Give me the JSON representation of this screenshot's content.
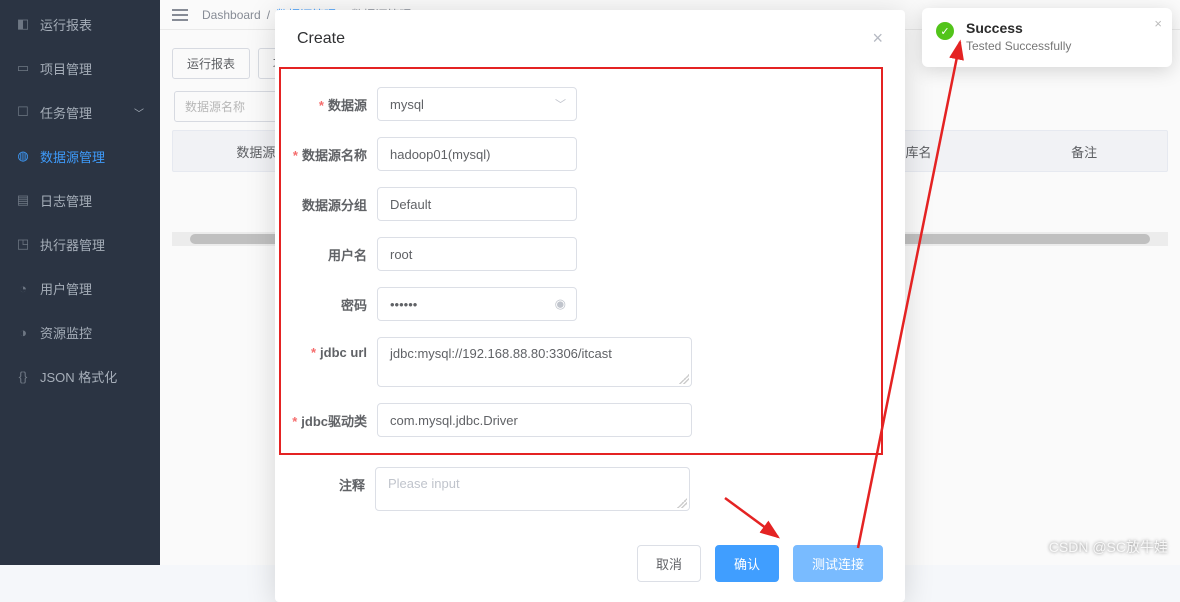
{
  "sidebar": {
    "items": [
      {
        "label": "运行报表"
      },
      {
        "label": "项目管理"
      },
      {
        "label": "任务管理"
      },
      {
        "label": "数据源管理"
      },
      {
        "label": "日志管理"
      },
      {
        "label": "执行器管理"
      },
      {
        "label": "用户管理"
      },
      {
        "label": "资源监控"
      },
      {
        "label": "JSON 格式化"
      }
    ]
  },
  "breadcrumb": {
    "home": "Dashboard",
    "mid": "数据源管理",
    "last": "数据源管理"
  },
  "toolbar": {
    "btn1": "运行报表",
    "btn2": "项目",
    "search_placeholder": "数据源名称"
  },
  "table": {
    "col1": "数据源",
    "col2": "库名",
    "col3": "备注"
  },
  "modal": {
    "title": "Create",
    "labels": {
      "datasource": "数据源",
      "name": "数据源名称",
      "group": "数据源分组",
      "user": "用户名",
      "password": "密码",
      "jdbc": "jdbc url",
      "driver": "jdbc驱动类",
      "comment": "注释"
    },
    "values": {
      "datasource": "mysql",
      "name": "hadoop01(mysql)",
      "group": "Default",
      "user": "root",
      "password": "••••••",
      "jdbc": "jdbc:mysql://192.168.88.80:3306/itcast",
      "driver": "com.mysql.jdbc.Driver",
      "comment_placeholder": "Please input"
    },
    "buttons": {
      "cancel": "取消",
      "confirm": "确认",
      "test": "测试连接"
    }
  },
  "toast": {
    "title": "Success",
    "message": "Tested Successfully"
  },
  "watermark": "CSDN @SC放牛娃"
}
